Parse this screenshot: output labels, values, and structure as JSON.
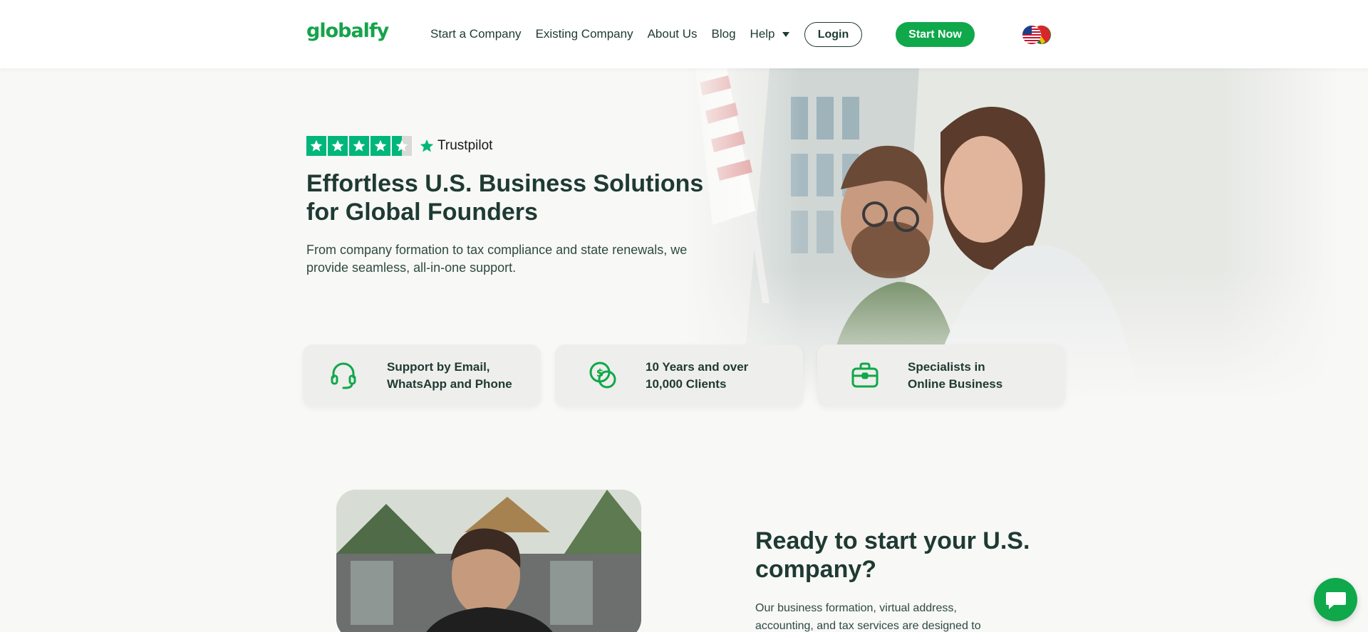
{
  "brand": {
    "logo_text": "globalfy",
    "accent_color": "#0fa84a",
    "text_color": "#1e3a33"
  },
  "nav": {
    "items": [
      {
        "label": "Start a Company"
      },
      {
        "label": "Existing Company"
      },
      {
        "label": "About Us"
      },
      {
        "label": "Blog"
      },
      {
        "label": "Help"
      }
    ],
    "login_label": "Login",
    "start_label": "Start Now",
    "language_icon": "flags-icon"
  },
  "hero": {
    "trustpilot": {
      "brand": "Trustpilot",
      "rating_stars": 4.5
    },
    "title": "Effortless U.S. Business Solutions for Global Founders",
    "subtitle": "From company formation to tax compliance and state renewals, we provide seamless, all-in-one support."
  },
  "features": [
    {
      "icon": "headset-icon",
      "line1": "Support by Email,",
      "line2": "WhatsApp and Phone"
    },
    {
      "icon": "coins-icon",
      "line1": "10 Years and over",
      "line2": "10,000 Clients"
    },
    {
      "icon": "briefcase-icon",
      "line1": "Specialists in",
      "line2": "Online Business"
    }
  ],
  "ready": {
    "title": "Ready to start your U.S. company?",
    "text": "Our business formation, virtual address, accounting, and tax services are designed to"
  },
  "chat": {
    "icon": "chat-bubble-icon"
  }
}
